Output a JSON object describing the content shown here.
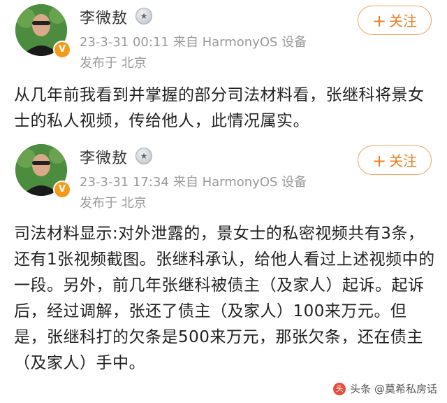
{
  "posts": [
    {
      "author": "李微敖",
      "medal_icon": "medal-icon",
      "verified_badge": "V",
      "follow_label": "关注",
      "timestamp": "23-3-31 00:11",
      "source": "来自 HarmonyOS 设备",
      "location": "发布于 北京",
      "text": "从几年前我看到并掌握的部分司法材料看，张继科将景女士的私人视频，传给他人，此情况属实。"
    },
    {
      "author": "李微敖",
      "medal_icon": "medal-icon",
      "verified_badge": "V",
      "follow_label": "关注",
      "timestamp": "23-3-31 17:34",
      "source": "来自 HarmonyOS 设备",
      "location": "发布于 北京",
      "text": "司法材料显示:对外泄露的，景女士的私密视频共有3条，还有1张视频截图。张继科承认，给他人看过上述视频中的一段。另外，前几年张继科被债主（及家人）起诉。起诉后，经过调解，张还了债主（及家人）100来万元。但是，张继科打的欠条是500来万元，那张欠条，还在债主（及家人）手中。"
    }
  ],
  "watermark": {
    "text": "头条 @莫希私房话"
  },
  "colors": {
    "accent": "#ee7d1b",
    "meta": "#999999",
    "badge": "#f39a1b"
  }
}
